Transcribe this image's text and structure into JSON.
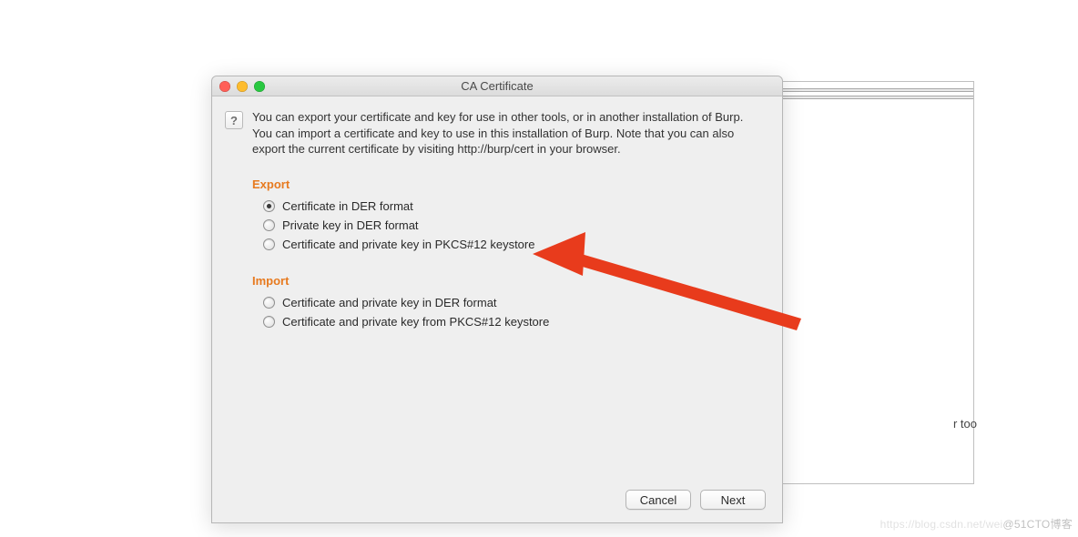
{
  "bg": {
    "fragment_text": "r too"
  },
  "dialog": {
    "title": "CA Certificate",
    "help_glyph": "?",
    "intro": "You can export your certificate and key for use in other tools, or in another installation of Burp. You can import a certificate and key to use in this installation of Burp. Note that you can also export the current certificate by visiting http://burp/cert in your browser.",
    "sections": {
      "export": {
        "heading": "Export",
        "options": [
          {
            "label": "Certificate in DER format",
            "selected": true
          },
          {
            "label": "Private key in DER format",
            "selected": false
          },
          {
            "label": "Certificate and private key in PKCS#12 keystore",
            "selected": false
          }
        ]
      },
      "import": {
        "heading": "Import",
        "options": [
          {
            "label": "Certificate and private key in DER format",
            "selected": false
          },
          {
            "label": "Certificate and private key from PKCS#12 keystore",
            "selected": false
          }
        ]
      }
    },
    "buttons": {
      "cancel": "Cancel",
      "next": "Next"
    }
  },
  "watermark": {
    "faint": "https://blog.csdn.net/wei",
    "main": "@51CTO博客"
  },
  "annotation": {
    "arrow_color": "#e83b1c"
  }
}
